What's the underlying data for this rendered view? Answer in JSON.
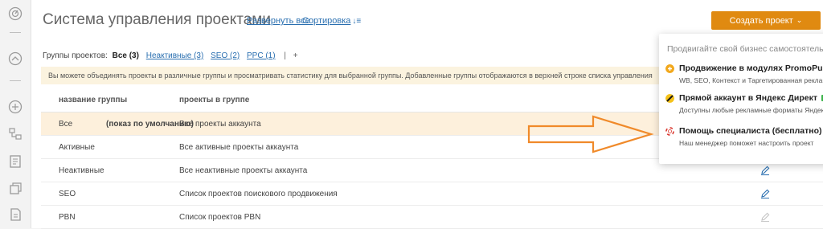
{
  "sidebar": {
    "icons": [
      "speedometer-icon",
      "speedometer-icon",
      "hierarchy-icon",
      "sitemap-icon",
      "report-icon",
      "stack-icon",
      "document-icon"
    ]
  },
  "header": {
    "title": "Система управления проектами",
    "expand_all": "Развернуть все",
    "sort": "Сортировка",
    "create_button": "Создать проект"
  },
  "groups": {
    "label": "Группы проектов:",
    "active": "Все (3)",
    "links": [
      "Неактивные (3)",
      "SEO (2)",
      "PPC (1)"
    ],
    "separator": "|",
    "add": "+"
  },
  "info_text": "Вы можете объединять проекты в различные группы и просматривать статистику для выбранной группы. Добавленные группы отображаются в верхней строке списка управления",
  "table": {
    "columns": [
      "название группы",
      "проекты в группе"
    ],
    "rows": [
      {
        "name": "Все",
        "note": "(показ по умолчанию)",
        "desc": "Все проекты аккаунта",
        "edit": false,
        "highlight": true
      },
      {
        "name": "Активные",
        "note": "",
        "desc": "Все активные проекты аккаунта",
        "edit": false,
        "highlight": false
      },
      {
        "name": "Неактивные",
        "note": "",
        "desc": "Все неактивные проекты аккаунта",
        "edit": true,
        "editable": true,
        "highlight": false
      },
      {
        "name": "SEO",
        "note": "",
        "desc": "Список проектов поискового продвижения",
        "edit": true,
        "editable": true,
        "highlight": false
      },
      {
        "name": "PBN",
        "note": "",
        "desc": "Список проектов PBN",
        "edit": true,
        "editable": false,
        "highlight": false
      }
    ]
  },
  "dropdown": {
    "header": "Продвигайте свой бизнес самостоятельно",
    "items": [
      {
        "title": "Продвижение в модулях PromoPult",
        "sub": "WB, SEO, Контекст и Таргетированная реклама",
        "icon": "promopult-icon",
        "color": "#f2a81c"
      },
      {
        "title": "Прямой аккаунт в Яндекс Директ",
        "badge": "new",
        "sub": "Доступны любые рекламные форматы Яндекс",
        "icon": "yandex-direct-icon",
        "color": "#f5c21a"
      },
      {
        "title": "Помощь специалиста (бесплатно)",
        "sub": "Наш менеджер поможет настроить проект",
        "icon": "lifebuoy-icon",
        "color": "#d9342b"
      }
    ]
  },
  "colors": {
    "accent": "#e08a11",
    "link": "#2a6fb0",
    "highlight_row": "#fdf0dc",
    "info_bg": "#fbf3df",
    "arrow": "#f08a2a"
  }
}
